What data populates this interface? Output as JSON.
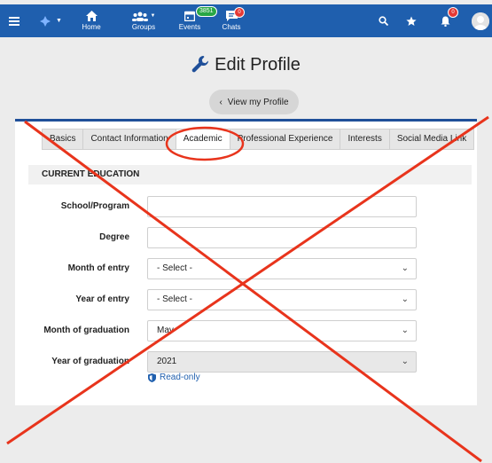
{
  "header": {
    "nav_items": [
      {
        "icon": "home-icon",
        "label": "Home"
      },
      {
        "icon": "groups-icon",
        "label": "Groups"
      },
      {
        "icon": "calendar-icon",
        "label": "Events",
        "count": "3851"
      },
      {
        "icon": "chat-icon",
        "label": "Chats",
        "badge": "0"
      }
    ],
    "notification_badge": "0",
    "accent_color": "#1f5fae"
  },
  "page": {
    "title": "Edit Profile",
    "view_profile_label": "View my Profile"
  },
  "tabs": [
    {
      "label": "Basics",
      "active": false
    },
    {
      "label": "Contact Information",
      "active": false
    },
    {
      "label": "Academic",
      "active": true
    },
    {
      "label": "Professional Experience",
      "active": false
    },
    {
      "label": "Interests",
      "active": false
    },
    {
      "label": "Social Media Link",
      "active": false
    }
  ],
  "form": {
    "section_title": "CURRENT EDUCATION",
    "fields": {
      "school": {
        "label": "School/Program",
        "value": ""
      },
      "degree": {
        "label": "Degree",
        "value": ""
      },
      "month_entry": {
        "label": "Month of entry",
        "value": "- Select -"
      },
      "year_entry": {
        "label": "Year of entry",
        "value": "- Select -"
      },
      "month_grad": {
        "label": "Month of graduation",
        "value": "May"
      },
      "year_grad": {
        "label": "Year of graduation",
        "value": "2021"
      }
    },
    "readonly_label": "Read-only"
  },
  "annotation_color": "#e8341c"
}
